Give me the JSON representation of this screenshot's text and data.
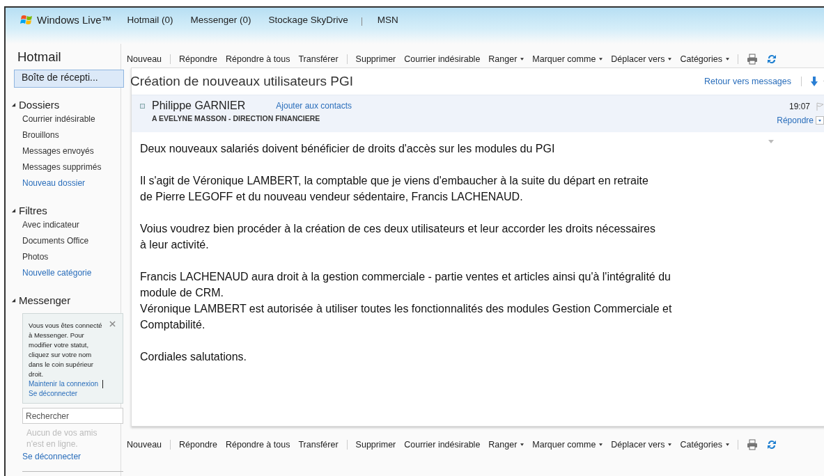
{
  "header": {
    "brand": "Windows Live™",
    "nav": [
      {
        "kind": "link",
        "label": "Hotmail (0)"
      },
      {
        "kind": "link",
        "label": "Messenger (0)"
      },
      {
        "kind": "link",
        "label": "Stockage SkyDrive"
      },
      {
        "kind": "divider"
      },
      {
        "kind": "link",
        "label": "MSN"
      }
    ]
  },
  "sidebar": {
    "title": "Hotmail",
    "inbox": {
      "label": "Boîte de récepti...",
      "selected": true
    },
    "sections": [
      {
        "title": "Dossiers",
        "expanded": true,
        "items": [
          {
            "kind": "item",
            "label": "Courrier indésirable"
          },
          {
            "kind": "item",
            "label": "Brouillons"
          },
          {
            "kind": "item",
            "label": "Messages envoyés"
          },
          {
            "kind": "item",
            "label": "Messages supprimés"
          },
          {
            "kind": "link",
            "label": "Nouveau dossier"
          }
        ]
      },
      {
        "title": "Filtres",
        "expanded": true,
        "items": [
          {
            "kind": "item",
            "label": "Avec indicateur"
          },
          {
            "kind": "item",
            "label": "Documents Office"
          },
          {
            "kind": "item",
            "label": "Photos"
          },
          {
            "kind": "link",
            "label": "Nouvelle catégorie"
          }
        ]
      },
      {
        "title": "Messenger",
        "expanded": true
      }
    ],
    "messenger": {
      "notice": "Vous vous êtes connecté à Messenger. Pour modifier votre statut, cliquez sur votre nom dans le coin supérieur droit.",
      "keep_link": "Maintenir la connexion",
      "signout_link": "Se déconnecter",
      "search": {
        "placeholder": "Rechercher"
      },
      "status": "Aucun de vos amis n'est en ligne.",
      "signout": "Se déconnecter"
    }
  },
  "toolbar_top": [
    {
      "kind": "action",
      "label": "Nouveau"
    },
    {
      "kind": "divider"
    },
    {
      "kind": "action",
      "label": "Répondre"
    },
    {
      "kind": "action",
      "label": "Répondre à tous"
    },
    {
      "kind": "action",
      "label": "Transférer"
    },
    {
      "kind": "divider"
    },
    {
      "kind": "action",
      "label": "Supprimer"
    },
    {
      "kind": "action",
      "label": "Courrier indésirable"
    },
    {
      "kind": "menu",
      "label": "Ranger"
    },
    {
      "kind": "menu",
      "label": "Marquer comme"
    },
    {
      "kind": "menu",
      "label": "Déplacer vers"
    },
    {
      "kind": "menu",
      "label": "Catégories"
    },
    {
      "kind": "divider"
    },
    {
      "kind": "print"
    },
    {
      "kind": "refresh"
    }
  ],
  "message": {
    "subject": "Création de nouveaux utilisateurs PGI",
    "back_link": "Retour vers messages",
    "sender": "Philippe GARNIER",
    "add_contact": "Ajouter aux contacts",
    "to": "A EVELYNE MASSON - DIRECTION FINANCIERE",
    "time": "19:07",
    "reply": "Répondre",
    "body": [
      [
        "Deux nouveaux salariés doivent bénéficier de droits d'accès sur les modules du PGI"
      ],
      [
        "Il s'agit de Véronique LAMBERT, la comptable que je viens d'embaucher à la suite du départ en retraite",
        "de Pierre LEGOFF et  du nouveau vendeur sédentaire, Francis LACHENAUD."
      ],
      [
        "Voius voudrez bien procéder à la création de ces deux utilisateurs et leur accorder les droits nécessaires",
        "à leur activité."
      ],
      [
        "Francis LACHENAUD aura droit à la gestion commerciale - partie ventes et articles ainsi qu'à l'intégralité du",
        "module de CRM.",
        "Véronique LAMBERT est autorisée à utiliser toutes les fonctionnalités des modules Gestion Commerciale et",
        "Comptabilité."
      ],
      [
        "Cordiales salutations."
      ]
    ]
  },
  "toolbar_bottom": [
    {
      "kind": "action",
      "label": "Nouveau"
    },
    {
      "kind": "divider"
    },
    {
      "kind": "action",
      "label": "Répondre"
    },
    {
      "kind": "action",
      "label": "Répondre à tous"
    },
    {
      "kind": "action",
      "label": "Transférer"
    },
    {
      "kind": "divider"
    },
    {
      "kind": "action",
      "label": "Supprimer"
    },
    {
      "kind": "action",
      "label": "Courrier indésirable"
    },
    {
      "kind": "menu",
      "label": "Ranger"
    },
    {
      "kind": "menu",
      "label": "Marquer comme"
    },
    {
      "kind": "menu",
      "label": "Déplacer vers"
    },
    {
      "kind": "menu",
      "label": "Catégories"
    },
    {
      "kind": "divider"
    },
    {
      "kind": "print"
    },
    {
      "kind": "refresh"
    }
  ]
}
